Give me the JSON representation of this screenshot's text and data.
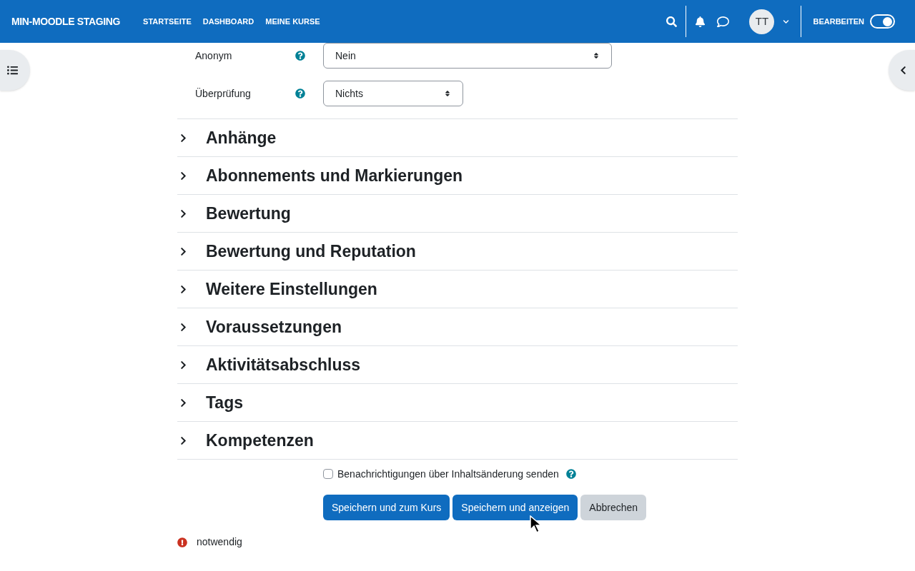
{
  "navbar": {
    "brand": "MIN-MOODLE STAGING",
    "links": [
      "STARTSEITE",
      "DASHBOARD",
      "MEINE KURSE"
    ],
    "avatar": "TT",
    "edit_mode": {
      "label": "BEARBEITEN",
      "on": true
    }
  },
  "fields": [
    {
      "label": "Anonym",
      "value": "Nein",
      "wide": true
    },
    {
      "label": "Überprüfung",
      "value": "Nichts",
      "wide": false
    }
  ],
  "sections": [
    {
      "title": "Anhänge",
      "expanded": false
    },
    {
      "title": "Abonnements und Markierungen",
      "expanded": false
    },
    {
      "title": "Bewertung",
      "expanded": false
    },
    {
      "title": "Bewertung und Reputation",
      "expanded": false
    },
    {
      "title": "Weitere Einstellungen",
      "expanded": false
    },
    {
      "title": "Voraussetzungen",
      "expanded": false
    },
    {
      "title": "Aktivitätsabschluss",
      "expanded": false
    },
    {
      "title": "Tags",
      "expanded": false
    },
    {
      "title": "Kompetenzen",
      "expanded": false
    }
  ],
  "notify": {
    "label": "Benachrichtigungen über Inhaltsänderung senden",
    "checked": false
  },
  "buttons": [
    {
      "label": "Speichern und zum Kurs",
      "kind": "primary"
    },
    {
      "label": "Speichern und anzeigen",
      "kind": "primary"
    },
    {
      "label": "Abbrechen",
      "kind": "secondary"
    }
  ],
  "required_note": "notwendig"
}
